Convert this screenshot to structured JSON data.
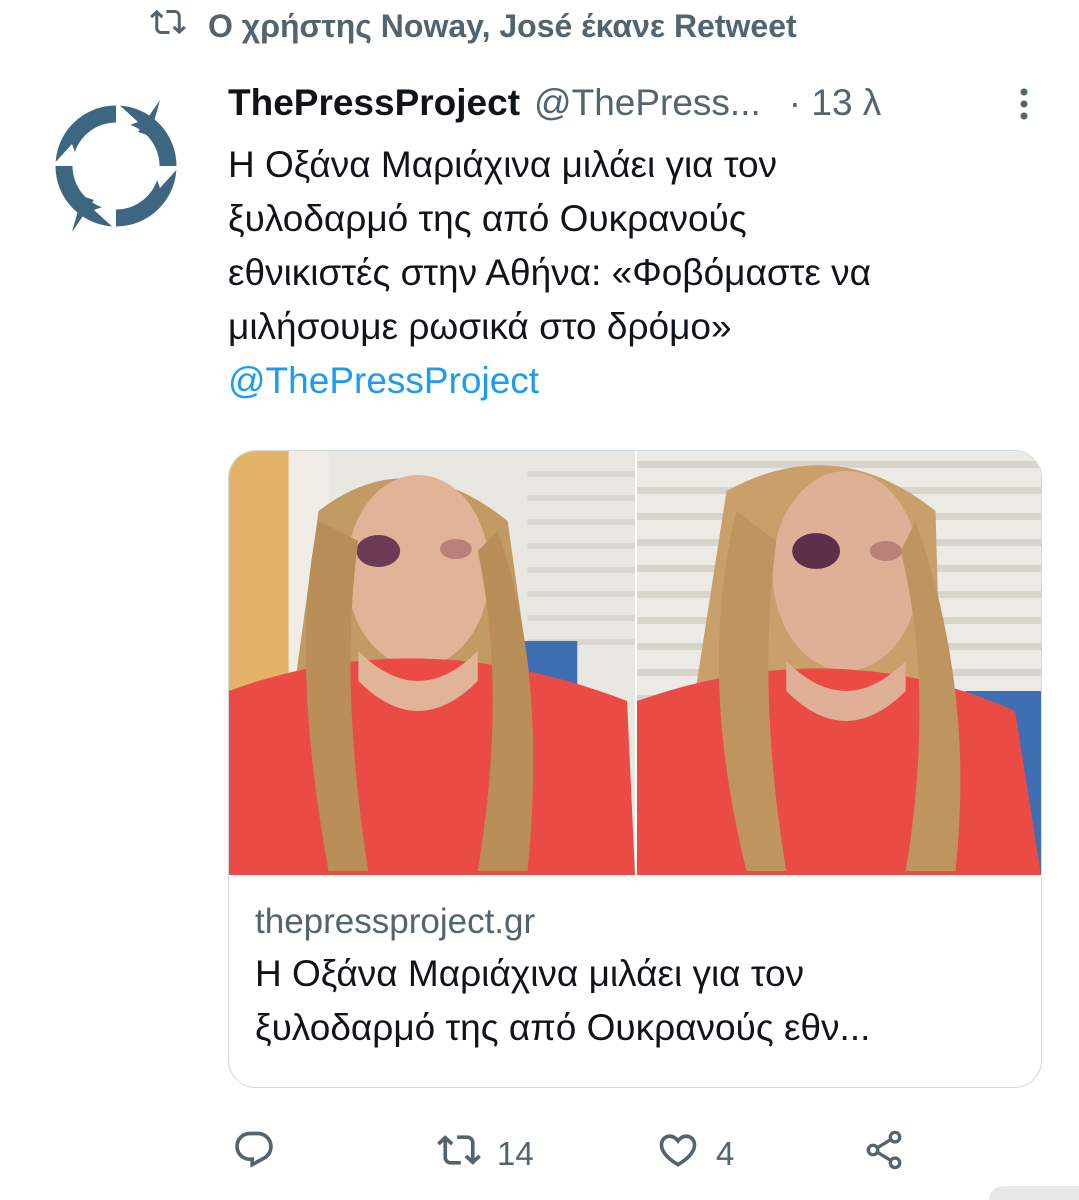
{
  "retweet_context": {
    "text": "Ο χρήστης Noway, José έκανε Retweet",
    "icon": "retweet-icon"
  },
  "tweet": {
    "author_name": "ThePressProject",
    "handle": "@ThePress...",
    "time": "· 13 λ",
    "text_lines": [
      "Η Οξάνα Μαριάχινα μιλάει για τον",
      "ξυλοδαρμό της από Ουκρανούς",
      "εθνικιστές στην Αθήνα: «Φοβόμαστε να",
      "μιλήσουμε ρωσικά στο δρόμο»"
    ],
    "mention": "@ThePressProject",
    "avatar_color": "#3d6680"
  },
  "link_card": {
    "domain": "thepressproject.gr",
    "title_lines": [
      "Η Οξάνα Μαριάχινα μιλάει για τον",
      "ξυλοδαρμό της από Ουκρανούς εθν..."
    ]
  },
  "actions": {
    "reply_icon": "reply-icon",
    "retweet_count": "14",
    "like_count": "4",
    "share_icon": "share-icon"
  },
  "colors": {
    "text_primary": "#0f1419",
    "text_secondary": "#536471",
    "link": "#1d9bf0",
    "card_border": "#cfd9de"
  }
}
